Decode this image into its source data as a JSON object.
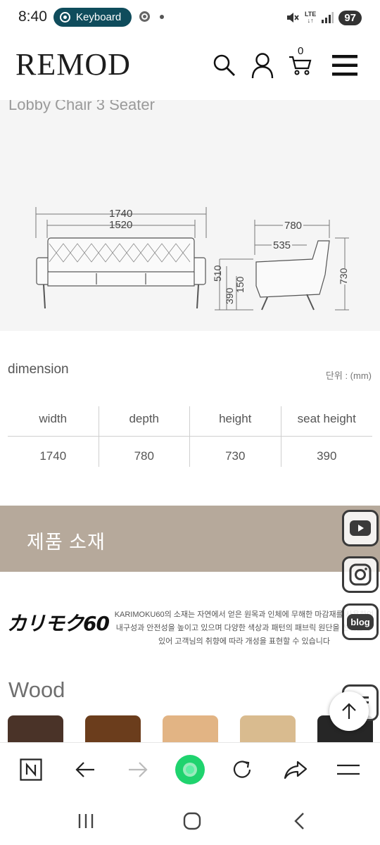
{
  "status_bar": {
    "time": "8:40",
    "notification_pill": "Keyboard",
    "network": "LTE",
    "battery": "97"
  },
  "header": {
    "logo": "REMOD",
    "cart_count": "0"
  },
  "product": {
    "title": "Lobby Chair 3 Seater",
    "front_view": {
      "overall_width": "1740",
      "inner_width": "1520",
      "height_labels": [
        "510",
        "390",
        "150"
      ]
    },
    "side_view": {
      "depth": "780",
      "seat_depth": "535",
      "height": "730"
    }
  },
  "dimension": {
    "title": "dimension",
    "unit": "단위 : (mm)",
    "headers": [
      "width",
      "depth",
      "height",
      "seat height"
    ],
    "values": [
      "1740",
      "780",
      "730",
      "390"
    ]
  },
  "material": {
    "title": "제품 소재"
  },
  "karimoku": {
    "logo": "カリモク60",
    "text": "KARIMOKU60의 소재는 자연에서 얻은 원목과 인체에 무해한 마감재를 사용하여 내구성과 안전성을 높이고 있으며 다양한 색상과 패턴의 패브릭 원단을 선택할 수 있어 고객님의 취향에 따라 개성을 표현할 수 있습니다"
  },
  "wood": {
    "title": "Wood",
    "swatch_colors": [
      "#4a3328",
      "#6b3d1c",
      "#e2b484",
      "#d9bb8f",
      "#262626"
    ]
  },
  "floating": {
    "youtube": "youtube-icon",
    "instagram": "instagram-icon",
    "blog_label": "blog"
  }
}
